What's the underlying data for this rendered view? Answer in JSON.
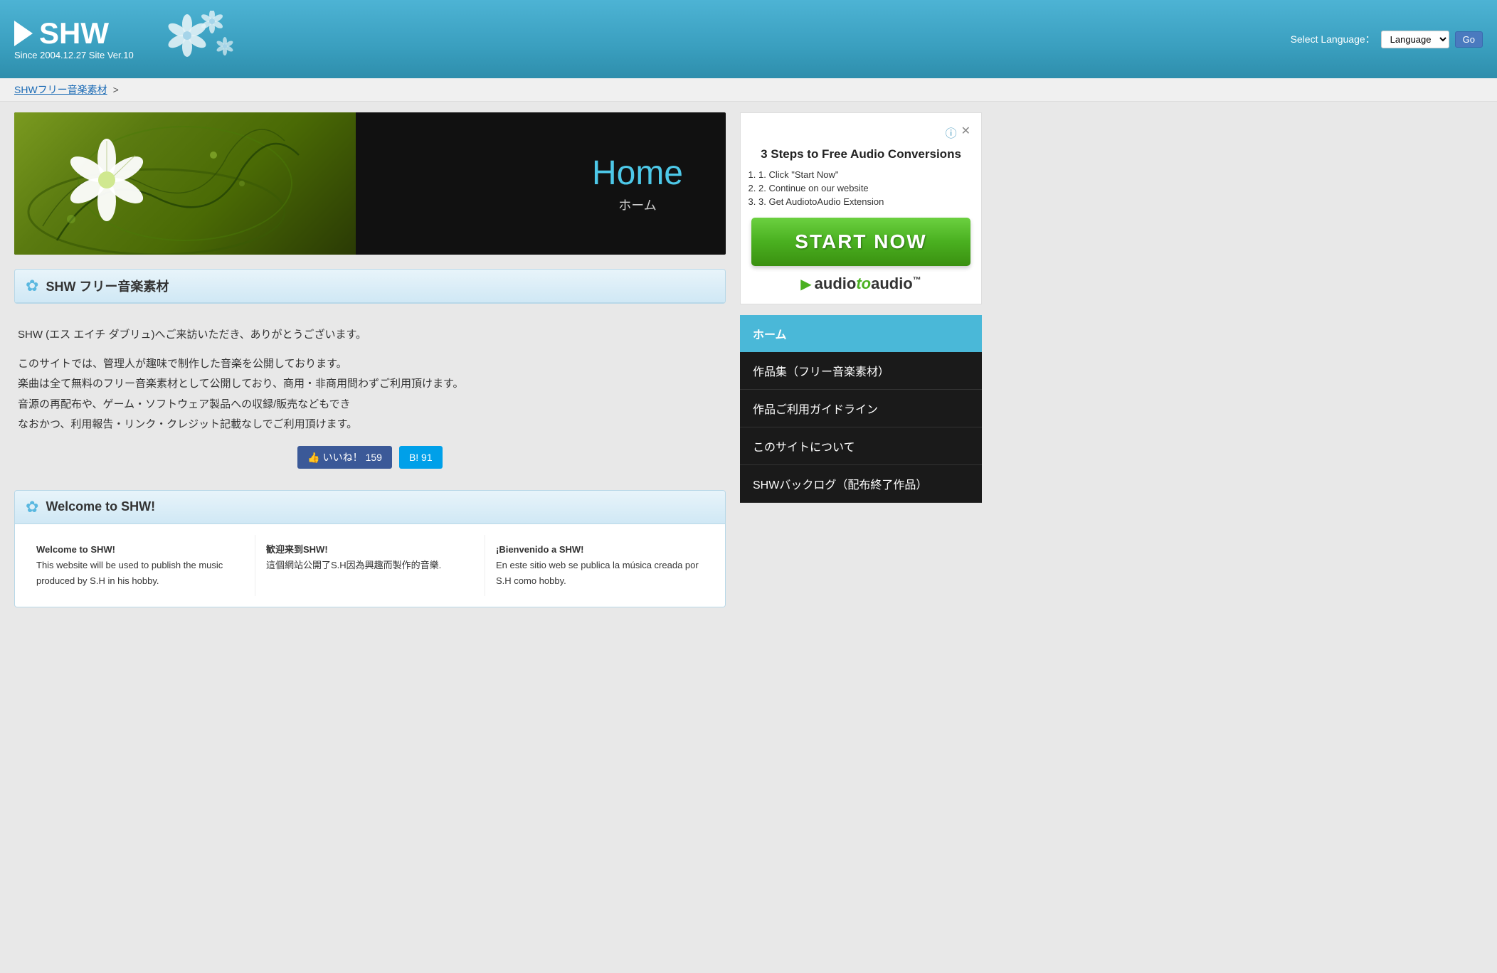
{
  "header": {
    "logo_title": "SHW",
    "logo_subtitle": "Since 2004.12.27  Site Ver.10",
    "lang_label": "Select Language：",
    "lang_button": "Go",
    "lang_placeholder": "Language"
  },
  "breadcrumb": {
    "link_text": "SHWフリー音楽素材",
    "separator": ">"
  },
  "hero": {
    "title_en": "Home",
    "title_jp": "ホーム"
  },
  "main_section": {
    "header_title": "SHW フリー音楽素材",
    "para1": "SHW (エス エイチ ダブリュ)へご来訪いただき、ありがとうございます。",
    "para2": "このサイトでは、管理人が趣味で制作した音楽を公開しております。\n楽曲は全て無料のフリー音楽素材として公開しており、商用・非商用問わずご利用頂けます。\n音源の再配布や、ゲーム・ソフトウェア製品への収録/販売などもでき\nなおかつ、利用報告・リンク・クレジット記載なしでご利用頂けます。",
    "fb_like": "👍 いいね！ 159",
    "hb_bookmark": "B! 91"
  },
  "welcome_section": {
    "header_title": "Welcome to SHW!",
    "col1_title": "Welcome to SHW!",
    "col1_text": "This website will be used to publish the music produced by S.H in his hobby.",
    "col2_title": "歓迎来到SHW!",
    "col2_text": "這個網站公開了S.H因為興趣而製作的音樂.",
    "col3_title": "¡Bienvenido a SHW!",
    "col3_text": "En este sitio web se publica la música creada por S.H como hobby."
  },
  "ad": {
    "title": "3 Steps to Free Audio Conversions",
    "step1": "1. Click \"Start Now\"",
    "step2": "2. Continue on our website",
    "step3": "3. Get AudiotoAudio Extension",
    "start_now": "START NOW",
    "brand_audio": "audio",
    "brand_to": "to",
    "brand_audio2": "audio",
    "brand_tm": "™"
  },
  "nav": {
    "items": [
      {
        "label": "ホーム",
        "active": true
      },
      {
        "label": "作品集（フリー音楽素材）",
        "active": false
      },
      {
        "label": "作品ご利用ガイドライン",
        "active": false
      },
      {
        "label": "このサイトについて",
        "active": false
      },
      {
        "label": "SHWバックログ（配布終了作品）",
        "active": false
      }
    ]
  }
}
